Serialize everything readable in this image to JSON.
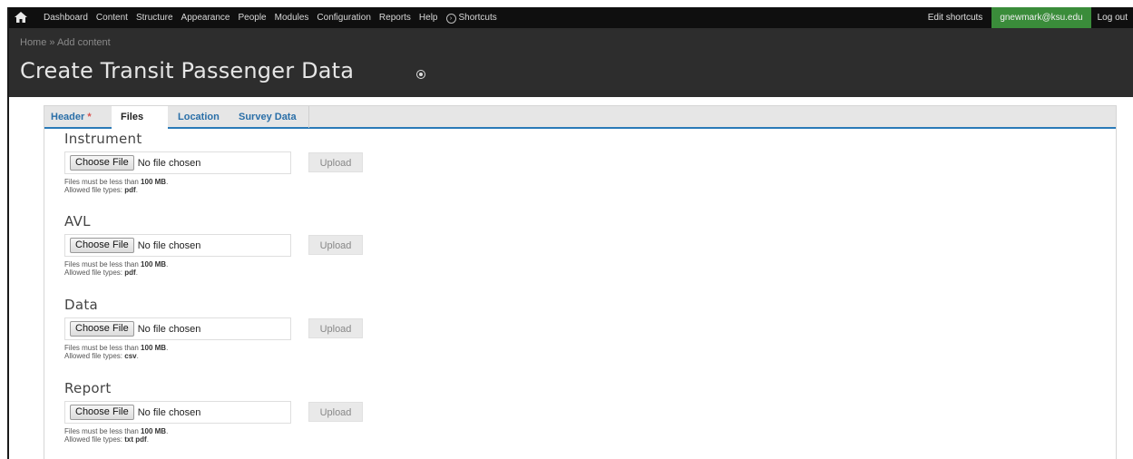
{
  "toolbar": {
    "menu": [
      "Dashboard",
      "Content",
      "Structure",
      "Appearance",
      "People",
      "Modules",
      "Configuration",
      "Reports",
      "Help"
    ],
    "shortcuts_label": "Shortcuts",
    "edit_shortcuts": "Edit shortcuts",
    "user": "gnewmark@ksu.edu",
    "logout": "Log out",
    "icons": {
      "home": "home-icon",
      "shortcuts": "shortcuts-icon"
    },
    "colors": {
      "bar": "#0f0f0f",
      "user_bg": "#3a8c3a"
    }
  },
  "header": {
    "breadcrumb": "Home » Add content",
    "title": "Create Transit Passenger Data",
    "add_shortcut_icon": "add-shortcut-icon"
  },
  "tabs": [
    {
      "label": "Header",
      "required": "*",
      "active": false
    },
    {
      "label": "Files",
      "active": true
    },
    {
      "label": "Location",
      "active": false
    },
    {
      "label": "Survey Data",
      "active": false
    }
  ],
  "fields": [
    {
      "label": "Instrument",
      "choose": "Choose File",
      "status": "No file chosen",
      "upload": "Upload",
      "size_prefix": "Files must be less than",
      "size": "100 MB",
      "types_prefix": "Allowed file types:",
      "types": "pdf"
    },
    {
      "label": "AVL",
      "choose": "Choose File",
      "status": "No file chosen",
      "upload": "Upload",
      "size_prefix": "Files must be less than",
      "size": "100 MB",
      "types_prefix": "Allowed file types:",
      "types": "pdf"
    },
    {
      "label": "Data",
      "choose": "Choose File",
      "status": "No file chosen",
      "upload": "Upload",
      "size_prefix": "Files must be less than",
      "size": "100 MB",
      "types_prefix": "Allowed file types:",
      "types": "csv"
    },
    {
      "label": "Report",
      "choose": "Choose File",
      "status": "No file chosen",
      "upload": "Upload",
      "size_prefix": "Files must be less than",
      "size": "100 MB",
      "types_prefix": "Allowed file types:",
      "types": "txt pdf"
    }
  ]
}
